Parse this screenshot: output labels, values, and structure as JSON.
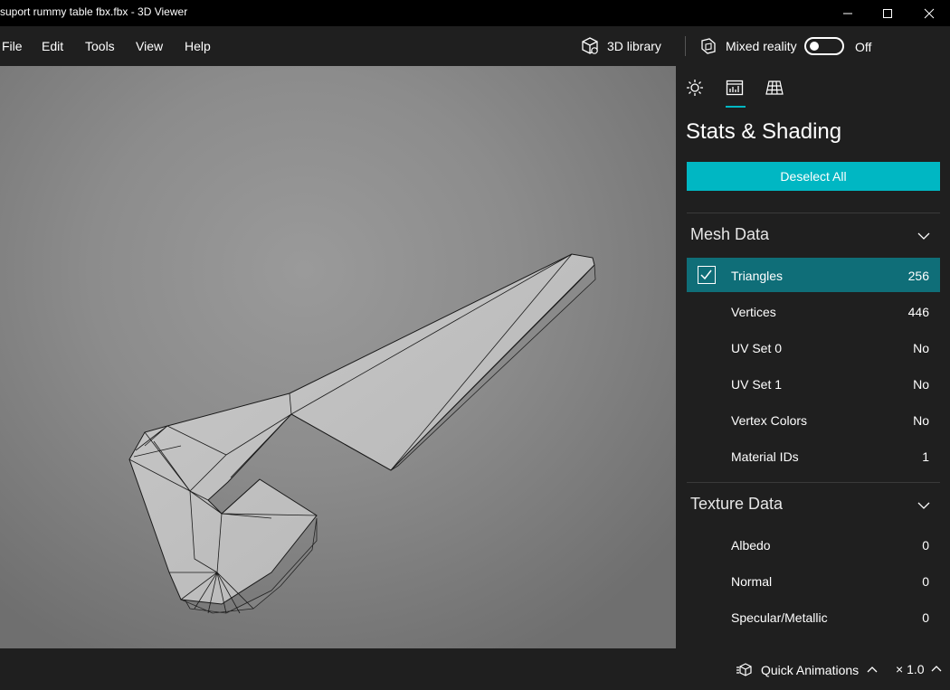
{
  "window": {
    "title": "suport rummy table fbx.fbx - 3D Viewer"
  },
  "menu": {
    "items": [
      "File",
      "Edit",
      "Tools",
      "View",
      "Help"
    ],
    "library_label": "3D library",
    "mixed_reality_label": "Mixed reality",
    "mixed_reality_state": "Off"
  },
  "panel": {
    "tabs": [
      "lighting-icon",
      "stats-icon",
      "grid-icon"
    ],
    "active_tab": "stats-icon",
    "title": "Stats & Shading",
    "deselect_label": "Deselect All",
    "mesh": {
      "heading": "Mesh Data",
      "rows": [
        {
          "label": "Triangles",
          "value": "256",
          "selected": true
        },
        {
          "label": "Vertices",
          "value": "446"
        },
        {
          "label": "UV Set 0",
          "value": "No"
        },
        {
          "label": "UV Set 1",
          "value": "No"
        },
        {
          "label": "Vertex Colors",
          "value": "No"
        },
        {
          "label": "Material IDs",
          "value": "1"
        }
      ]
    },
    "texture": {
      "heading": "Texture Data",
      "rows": [
        {
          "label": "Albedo",
          "value": "0"
        },
        {
          "label": "Normal",
          "value": "0"
        },
        {
          "label": "Specular/Metallic",
          "value": "0"
        }
      ]
    }
  },
  "bottom": {
    "animations_label": "Quick Animations",
    "speed_label": "× 1.0"
  },
  "colors": {
    "accent": "#00b7c3",
    "selected_row": "#0f6e78",
    "panel_bg": "#1f1f1f"
  }
}
